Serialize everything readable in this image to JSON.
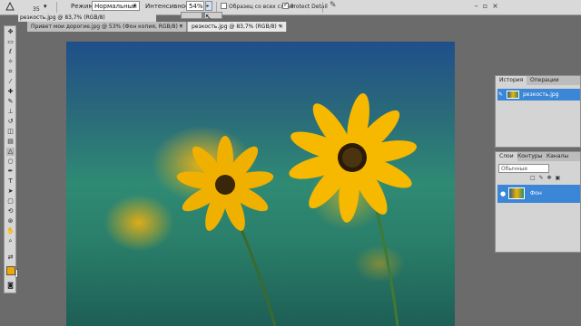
{
  "options_bar": {
    "brush_size": "35",
    "mode_label": "Режим:",
    "mode_value": "Нормальный",
    "intensity_label": "Интенсивность:",
    "intensity_value": "54%",
    "sample_all_layers": "Образец со всех слоев",
    "protect_detail": "Protect Detail",
    "icons": [
      "sharpen-tool-icon",
      "brush-picker-icon",
      "dropdown-arrow-icon",
      "checkbox-icon",
      "tablet-pressure-icon"
    ]
  },
  "document": {
    "title": "резкость.jpg @ 83,7% (RGB/8)",
    "tabs": [
      {
        "label": "Привет мои дорогие.jpg @ 53% (Фон копия, RGB/8) *",
        "active": false
      },
      {
        "label": "резкость.jpg @ 83,7% (RGB/8) *",
        "active": true
      }
    ]
  },
  "history_panel": {
    "tabs": [
      "История",
      "Операции"
    ],
    "items": [
      {
        "label": "резкость.jpg"
      }
    ]
  },
  "layers_panel": {
    "tabs": [
      "Слои",
      "Контуры",
      "Каналы"
    ],
    "blend_mode": "Обычные",
    "layers": [
      {
        "name": "Фон",
        "visible": true
      }
    ]
  },
  "colors": {
    "foreground": "#f1a800",
    "background": "#ffffff",
    "selection": "#3b86d6"
  }
}
